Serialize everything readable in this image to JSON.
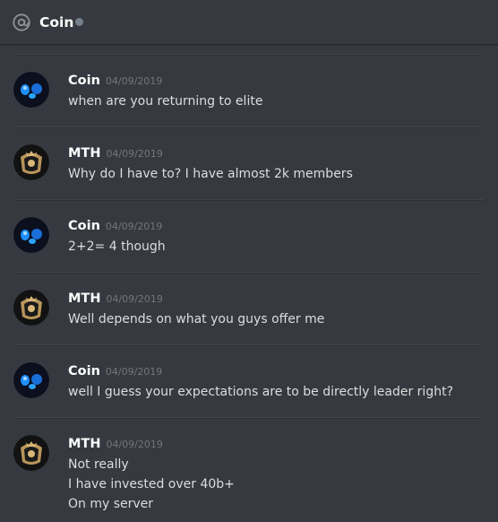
{
  "header": {
    "channel_name": "Coin",
    "status": "offline"
  },
  "messages": [
    {
      "author": "Coin",
      "timestamp": "04/09/2019",
      "avatar_icon": "blue-orb-avatar",
      "lines": [
        "when are you returning to elite"
      ]
    },
    {
      "author": "MTH",
      "timestamp": "04/09/2019",
      "avatar_icon": "gold-crest-avatar",
      "lines": [
        "Why do I have to? I have almost 2k members"
      ]
    },
    {
      "author": "Coin",
      "timestamp": "04/09/2019",
      "avatar_icon": "blue-orb-avatar",
      "lines": [
        "2+2= 4 though"
      ]
    },
    {
      "author": "MTH",
      "timestamp": "04/09/2019",
      "avatar_icon": "gold-crest-avatar",
      "lines": [
        "Well depends on what you guys offer me"
      ]
    },
    {
      "author": "Coin",
      "timestamp": "04/09/2019",
      "avatar_icon": "blue-orb-avatar",
      "lines": [
        "well I guess your expectations are to be directly leader right?"
      ]
    },
    {
      "author": "MTH",
      "timestamp": "04/09/2019",
      "avatar_icon": "gold-crest-avatar",
      "lines": [
        "Not really",
        "I have invested over 40b+",
        "On my server"
      ]
    }
  ],
  "colors": {
    "background": "#36393f",
    "author": "#ffffff",
    "text": "#dcddde",
    "timestamp": "#72767d",
    "status_offline": "#747f8d"
  }
}
